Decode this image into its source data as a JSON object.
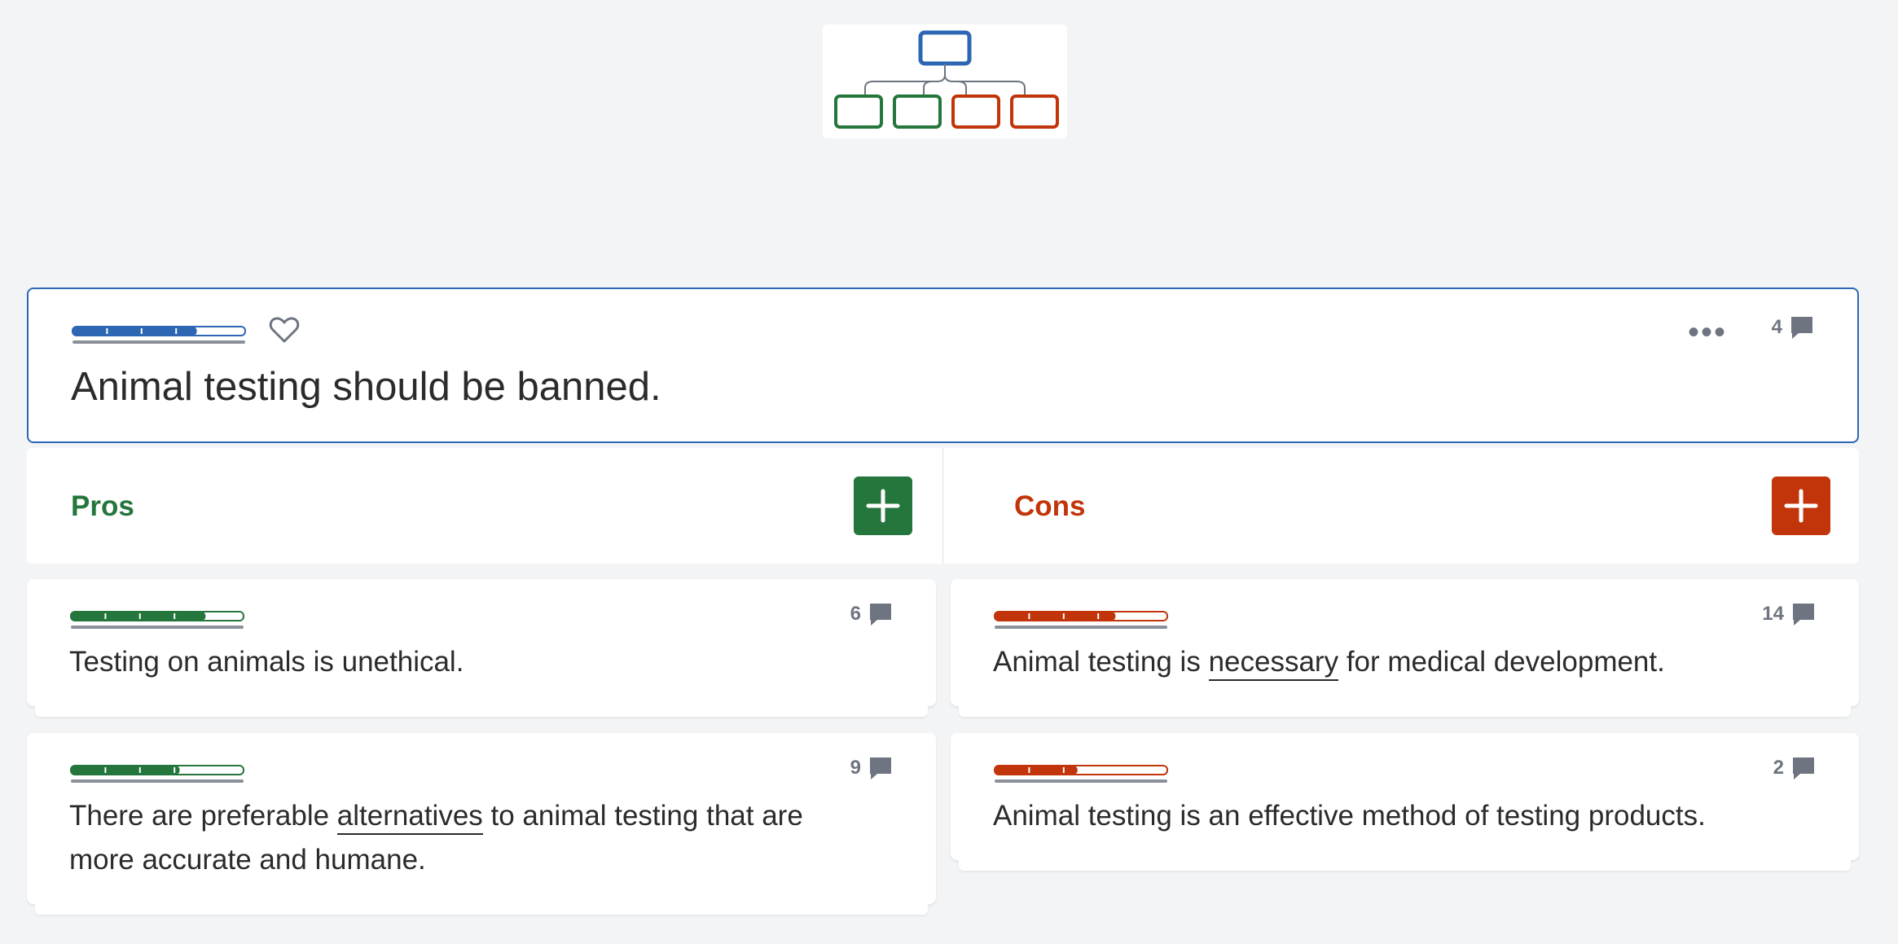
{
  "thesis": {
    "text": "Animal testing should be banned.",
    "comment_count": "4",
    "rating_fraction": 0.72,
    "color": "#2d67b3"
  },
  "columns": {
    "pros": {
      "label": "Pros",
      "color": "#25763d"
    },
    "cons": {
      "label": "Cons",
      "color": "#c2350b"
    }
  },
  "pros": [
    {
      "comment_count": "6",
      "rating_fraction": 0.78,
      "text_parts": [
        "Testing on animals is unethical."
      ]
    },
    {
      "comment_count": "9",
      "rating_fraction": 0.63,
      "text_pre": "There are preferable ",
      "term": "alternatives",
      "text_post": " to animal testing that are more accurate and humane."
    }
  ],
  "cons": [
    {
      "comment_count": "14",
      "rating_fraction": 0.7,
      "text_pre": "Animal testing is ",
      "term": "necessary",
      "text_post": " for medical development."
    },
    {
      "comment_count": "2",
      "rating_fraction": 0.48,
      "text_parts": [
        "Animal testing is an effective method of testing products."
      ]
    }
  ],
  "icons": {
    "tree": "argument-tree-icon",
    "favorite": "heart-icon",
    "more": "more-options-icon",
    "comment": "comment-icon",
    "add": "plus-icon"
  }
}
